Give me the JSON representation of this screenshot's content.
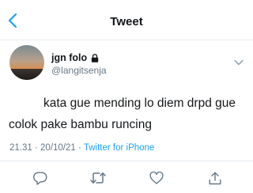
{
  "nav": {
    "title": "Tweet"
  },
  "author": {
    "display_name": "jgn folo",
    "handle": "@langitsenja"
  },
  "tweet": {
    "text": "kata gue mending lo diem drpd gue colok pake bambu runcing",
    "time": "21.31",
    "separator": "·",
    "date": "20/10/21",
    "source": "Twitter for iPhone"
  },
  "colors": {
    "accent": "#1da1f2",
    "secondary_text": "#657786",
    "primary_text": "#14171a"
  },
  "icons": {
    "back": "chevron-left-icon",
    "protected": "lock-icon",
    "more": "chevron-down-icon",
    "reply": "reply-icon",
    "retweet": "retweet-icon",
    "like": "heart-icon",
    "share": "share-icon"
  }
}
